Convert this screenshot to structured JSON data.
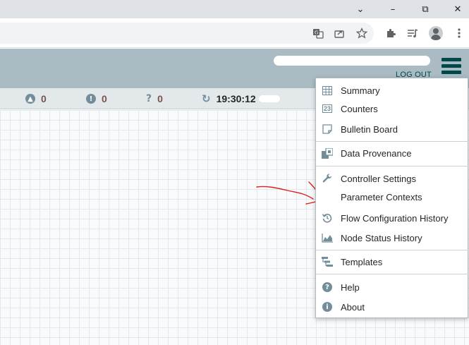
{
  "browser": {
    "window_controls": {
      "minimize": "–",
      "restore": "⧉",
      "close": "✕",
      "tabs_dropdown": "⌄"
    },
    "toolbar_icons": [
      "translate-icon",
      "share-icon",
      "bookmark-star-icon",
      "extensions-icon",
      "reading-list-icon",
      "profile-icon",
      "more-icon"
    ]
  },
  "header": {
    "user_identity": "",
    "logout_label": "LOG OUT"
  },
  "status": {
    "up_to_date_count": "0",
    "locally_modified_count": "0",
    "unknown_count": "0",
    "last_refreshed": "19:30:12"
  },
  "menu": {
    "groups": [
      [
        {
          "label": "Summary",
          "icon": "table-icon"
        },
        {
          "label": "Counters",
          "icon": "counter-icon"
        },
        {
          "label": "Bulletin Board",
          "icon": "sticky-note-icon"
        }
      ],
      [
        {
          "label": "Data Provenance",
          "icon": "provenance-icon"
        }
      ],
      [
        {
          "label": "Controller Settings",
          "icon": "wrench-icon"
        },
        {
          "label": "Parameter Contexts",
          "icon": ""
        },
        {
          "label": "Flow Configuration History",
          "icon": "history-icon"
        },
        {
          "label": "Node Status History",
          "icon": "area-chart-icon"
        }
      ],
      [
        {
          "label": "Templates",
          "icon": "templates-icon"
        }
      ],
      [
        {
          "label": "Help",
          "icon": "question-circle-icon"
        },
        {
          "label": "About",
          "icon": "info-circle-icon"
        }
      ]
    ]
  },
  "colors": {
    "header_bg": "#aabbc3",
    "brand_dark": "#004849",
    "status_bg": "#e3e8eb",
    "icon_grey": "#728e9b",
    "annotation_red": "#e02020"
  }
}
